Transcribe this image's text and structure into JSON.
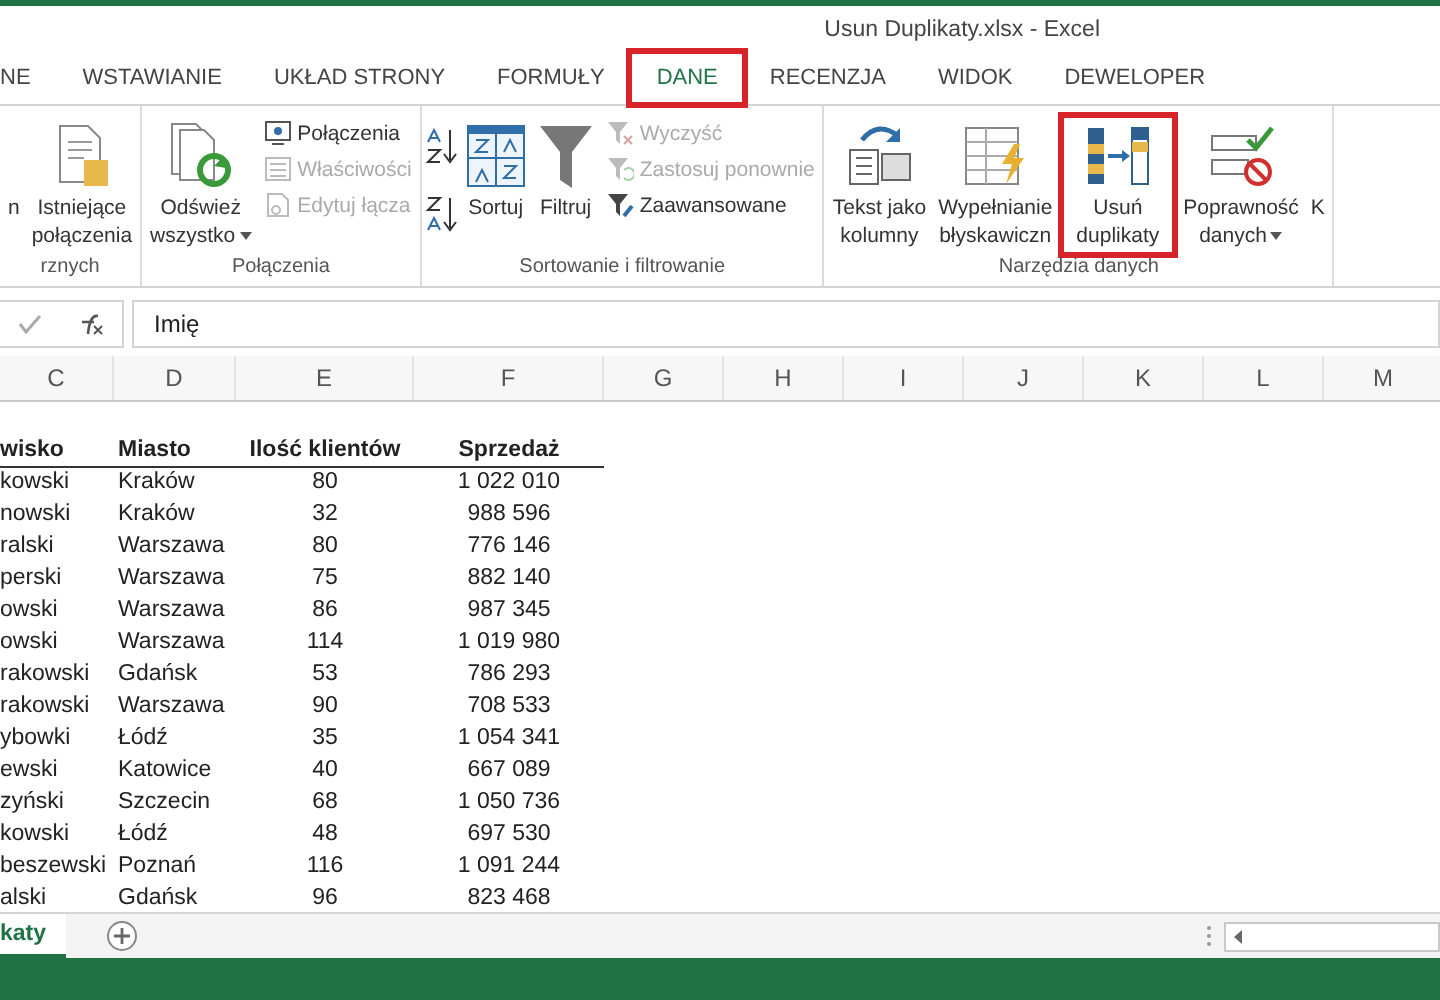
{
  "window": {
    "title": "Usun Duplikaty.xlsx - Excel"
  },
  "tabs": [
    {
      "label": "NE",
      "selected": false,
      "highlighted": false
    },
    {
      "label": "WSTAWIANIE",
      "selected": false,
      "highlighted": false
    },
    {
      "label": "UKŁAD STRONY",
      "selected": false,
      "highlighted": false
    },
    {
      "label": "FORMUŁY",
      "selected": false,
      "highlighted": false
    },
    {
      "label": "DANE",
      "selected": true,
      "highlighted": true
    },
    {
      "label": "RECENZJA",
      "selected": false,
      "highlighted": false
    },
    {
      "label": "WIDOK",
      "selected": false,
      "highlighted": false
    },
    {
      "label": "DEWELOPER",
      "selected": false,
      "highlighted": false
    }
  ],
  "ribbon": {
    "groups": [
      {
        "label": "rznych",
        "columns": [
          {
            "kind": "large",
            "lines": [
              "n"
            ],
            "dropdown": false,
            "highlighted": false
          },
          {
            "kind": "large",
            "lines": [
              "Istniejące",
              "połączenia"
            ],
            "dropdown": false,
            "highlighted": false
          }
        ]
      },
      {
        "label": "Połączenia",
        "columns": [
          {
            "kind": "large",
            "lines": [
              "Odśwież",
              "wszystko"
            ],
            "dropdown": true,
            "highlighted": false
          },
          {
            "kind": "stack",
            "items": [
              {
                "label": "Połączenia",
                "disabled": false
              },
              {
                "label": "Właściwości",
                "disabled": true
              },
              {
                "label": "Edytuj łącza",
                "disabled": true
              }
            ]
          }
        ]
      },
      {
        "label": "Sortowanie i filtrowanie",
        "columns": [
          {
            "kind": "sorticons"
          },
          {
            "kind": "large",
            "lines": [
              "Sortuj"
            ],
            "dropdown": false,
            "highlighted": false
          },
          {
            "kind": "large",
            "lines": [
              "Filtruj"
            ],
            "dropdown": false,
            "highlighted": false
          },
          {
            "kind": "stack",
            "items": [
              {
                "label": "Wyczyść",
                "disabled": true
              },
              {
                "label": "Zastosuj ponownie",
                "disabled": true
              },
              {
                "label": "Zaawansowane",
                "disabled": false
              }
            ]
          }
        ]
      },
      {
        "label": "Narzędzia danych",
        "columns": [
          {
            "kind": "large",
            "lines": [
              "Tekst jako",
              "kolumny"
            ],
            "dropdown": false,
            "highlighted": false
          },
          {
            "kind": "large",
            "lines": [
              "Wypełnianie",
              "błyskawiczn"
            ],
            "dropdown": false,
            "highlighted": false
          },
          {
            "kind": "large",
            "lines": [
              "Usuń",
              "duplikaty"
            ],
            "dropdown": false,
            "highlighted": true
          },
          {
            "kind": "large",
            "lines": [
              "Poprawność",
              "danych"
            ],
            "dropdown": true,
            "highlighted": false
          },
          {
            "kind": "large",
            "lines": [
              "K"
            ],
            "dropdown": false,
            "highlighted": false
          }
        ]
      }
    ]
  },
  "formula_bar": {
    "value": "Imię"
  },
  "sheet": {
    "columns": [
      "C",
      "D",
      "E",
      "F",
      "G",
      "H",
      "I",
      "J",
      "K",
      "L",
      "M"
    ],
    "header": [
      "wisko",
      "Miasto",
      "Ilość klientów",
      "Sprzedaż"
    ],
    "rows": [
      [
        "kowski",
        "Kraków",
        "80",
        "1 022 010"
      ],
      [
        "nowski",
        "Kraków",
        "32",
        "988 596"
      ],
      [
        "ralski",
        "Warszawa",
        "80",
        "776 146"
      ],
      [
        "perski",
        "Warszawa",
        "75",
        "882 140"
      ],
      [
        "owski",
        "Warszawa",
        "86",
        "987 345"
      ],
      [
        "owski",
        "Warszawa",
        "114",
        "1 019 980"
      ],
      [
        "rakowski",
        "Gdańsk",
        "53",
        "786 293"
      ],
      [
        "rakowski",
        "Warszawa",
        "90",
        "708 533"
      ],
      [
        "ybowki",
        "Łódź",
        "35",
        "1 054 341"
      ],
      [
        "ewski",
        "Katowice",
        "40",
        "667 089"
      ],
      [
        "zyński",
        "Szczecin",
        "68",
        "1 050 736"
      ],
      [
        "kowski",
        "Łódź",
        "48",
        "697 530"
      ],
      [
        "beszewski",
        "Poznań",
        "116",
        "1 091 244"
      ],
      [
        "alski",
        "Gdańsk",
        "96",
        "823 468"
      ]
    ]
  },
  "sheet_tabs": [
    {
      "label": "katy",
      "selected": true
    }
  ]
}
